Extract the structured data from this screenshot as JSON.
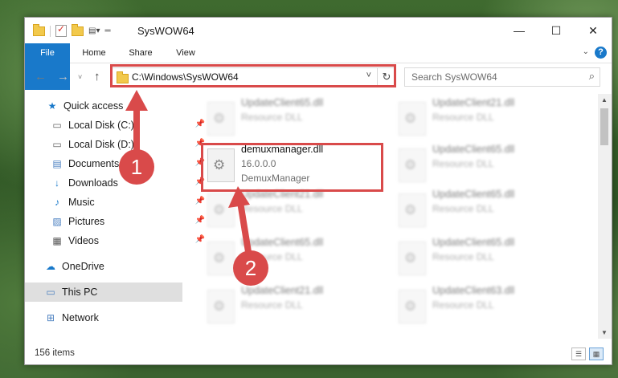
{
  "window": {
    "title": "SysWOW64"
  },
  "ribbon": {
    "tabs": [
      "File",
      "Home",
      "Share",
      "View"
    ],
    "help": "?"
  },
  "address": {
    "path": "C:\\Windows\\SysWOW64"
  },
  "search": {
    "placeholder": "Search SysWOW64"
  },
  "nav": {
    "items": [
      {
        "label": "Quick access"
      },
      {
        "label": "Local Disk (C:)"
      },
      {
        "label": "Local Disk (D:)"
      },
      {
        "label": "Documents"
      },
      {
        "label": "Downloads"
      },
      {
        "label": "Music"
      },
      {
        "label": "Pictures"
      },
      {
        "label": "Videos"
      },
      {
        "label": "OneDrive"
      },
      {
        "label": "This PC"
      },
      {
        "label": "Network"
      }
    ]
  },
  "files": {
    "highlighted": {
      "name": "demuxmanager.dll",
      "version": "16.0.0.0",
      "description": "DemuxManager"
    },
    "blurred": [
      {
        "name": "UpdateClient65.dll",
        "type": "Resource DLL"
      },
      {
        "name": "UpdateClient21.dll",
        "type": "Resource DLL"
      },
      {
        "name": "UpdateClient65.dll",
        "type": "Resource DLL"
      },
      {
        "name": "UpdateClient21.dll",
        "type": "Resource DLL"
      },
      {
        "name": "UpdateClient65.dll",
        "type": "Resource DLL"
      },
      {
        "name": "UpdateClient65.dll",
        "type": "Resource DLL"
      },
      {
        "name": "UpdateClient65.dll",
        "type": "Resource DLL"
      },
      {
        "name": "UpdateClient21.dll",
        "type": "Resource DLL"
      },
      {
        "name": "UpdateClient63.dll",
        "type": "Resource DLL"
      }
    ]
  },
  "status": {
    "items_count": "156 items"
  },
  "annotations": {
    "step1": "1",
    "step2": "2"
  },
  "colors": {
    "accent": "#1979ca",
    "callout": "#d94a4a"
  }
}
